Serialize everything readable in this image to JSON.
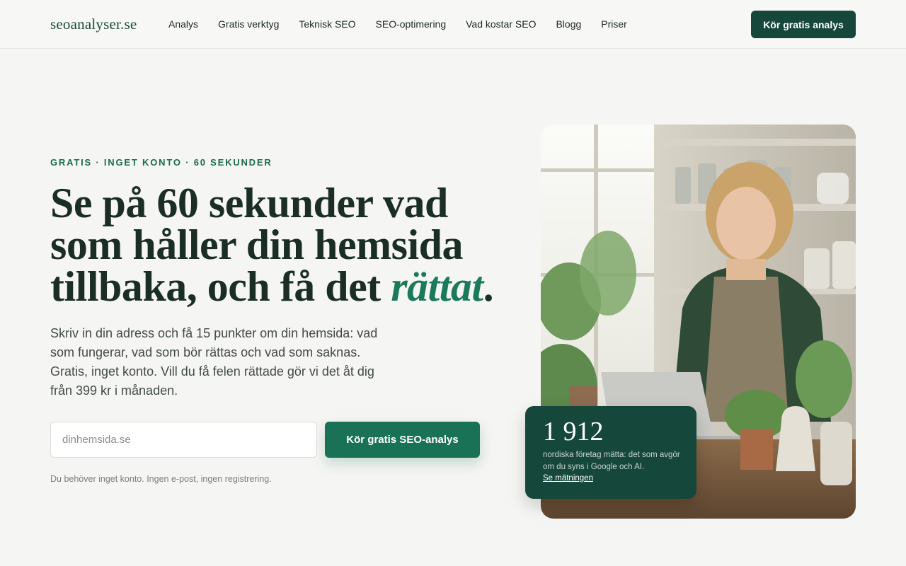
{
  "header": {
    "logo": "seoanalyser.se",
    "nav": [
      "Analys",
      "Gratis verktyg",
      "Teknisk SEO",
      "SEO-optimering",
      "Vad kostar SEO",
      "Blogg",
      "Priser"
    ],
    "cta_label": "Kör gratis analys"
  },
  "hero": {
    "eyebrow": "GRATIS · INGET KONTO · 60 SEKUNDER",
    "headline_main": "Se på 60 sekunder vad som håller din hemsida tillbaka, och få det ",
    "headline_emphasis": "rättat",
    "headline_end": ".",
    "lead": "Skriv in din adress och få 15 punkter om din hemsida: vad som fungerar, vad som bör rättas och vad som saknas. Gratis, inget konto. Vill du få felen rättade gör vi det åt dig från 399 kr i månaden.",
    "input_placeholder": "dinhemsida.se",
    "input_value": "",
    "cta_label": "Kör gratis SEO-analys",
    "note": "Du behöver inget konto. Ingen e-post, ingen registrering."
  },
  "stat_card": {
    "number": "1 912",
    "text": "nordiska företag mätta: det som avgör om du syns i Google och AI.",
    "link": "Se mätningen"
  },
  "colors": {
    "brand": "#15473a",
    "accent": "#197256",
    "background": "#f5f5f3"
  }
}
